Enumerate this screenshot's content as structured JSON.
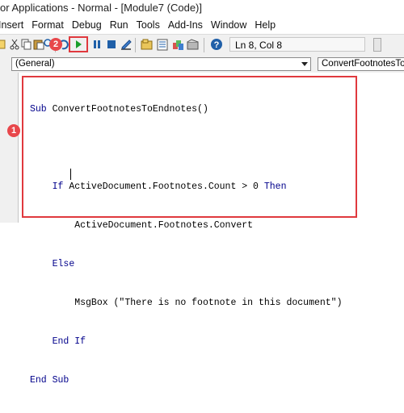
{
  "window": {
    "title": "or Applications - Normal - [Module7 (Code)]"
  },
  "menu": [
    {
      "label": "Insert"
    },
    {
      "label": "Format"
    },
    {
      "label": "Debug"
    },
    {
      "label": "Run"
    },
    {
      "label": "Tools"
    },
    {
      "label": "Add-Ins"
    },
    {
      "label": "Window"
    },
    {
      "label": "Help"
    }
  ],
  "toolbar": {
    "cursor_position": "Ln 8, Col 8",
    "icons": [
      "insert-object-icon",
      "cut-icon",
      "copy-icon",
      "paste-icon",
      "find-icon",
      "undo-icon",
      "redo-icon",
      "run-icon",
      "break-icon",
      "reset-icon",
      "design-mode-icon",
      "project-explorer-icon",
      "properties-icon",
      "object-browser-icon",
      "toolbox-icon",
      "help-icon"
    ]
  },
  "combos": {
    "object": "(General)",
    "procedure": "ConvertFootnotesToEndnotes"
  },
  "annotations": {
    "step1": "1",
    "step2": "2",
    "color": "#e0393e"
  },
  "code": {
    "line1": "Sub ConvertFootnotesToEndnotes()",
    "line2": "",
    "line3_kw1": "If",
    "line3_mid": " ActiveDocument.Footnotes.Count > 0 ",
    "line3_kw2": "Then",
    "line4": "ActiveDocument.Footnotes.Convert",
    "line5": "Else",
    "line6": "MsgBox (\"There is no footnote in this document\")",
    "line7_kw": "End If",
    "line8_kw": "End Sub"
  }
}
